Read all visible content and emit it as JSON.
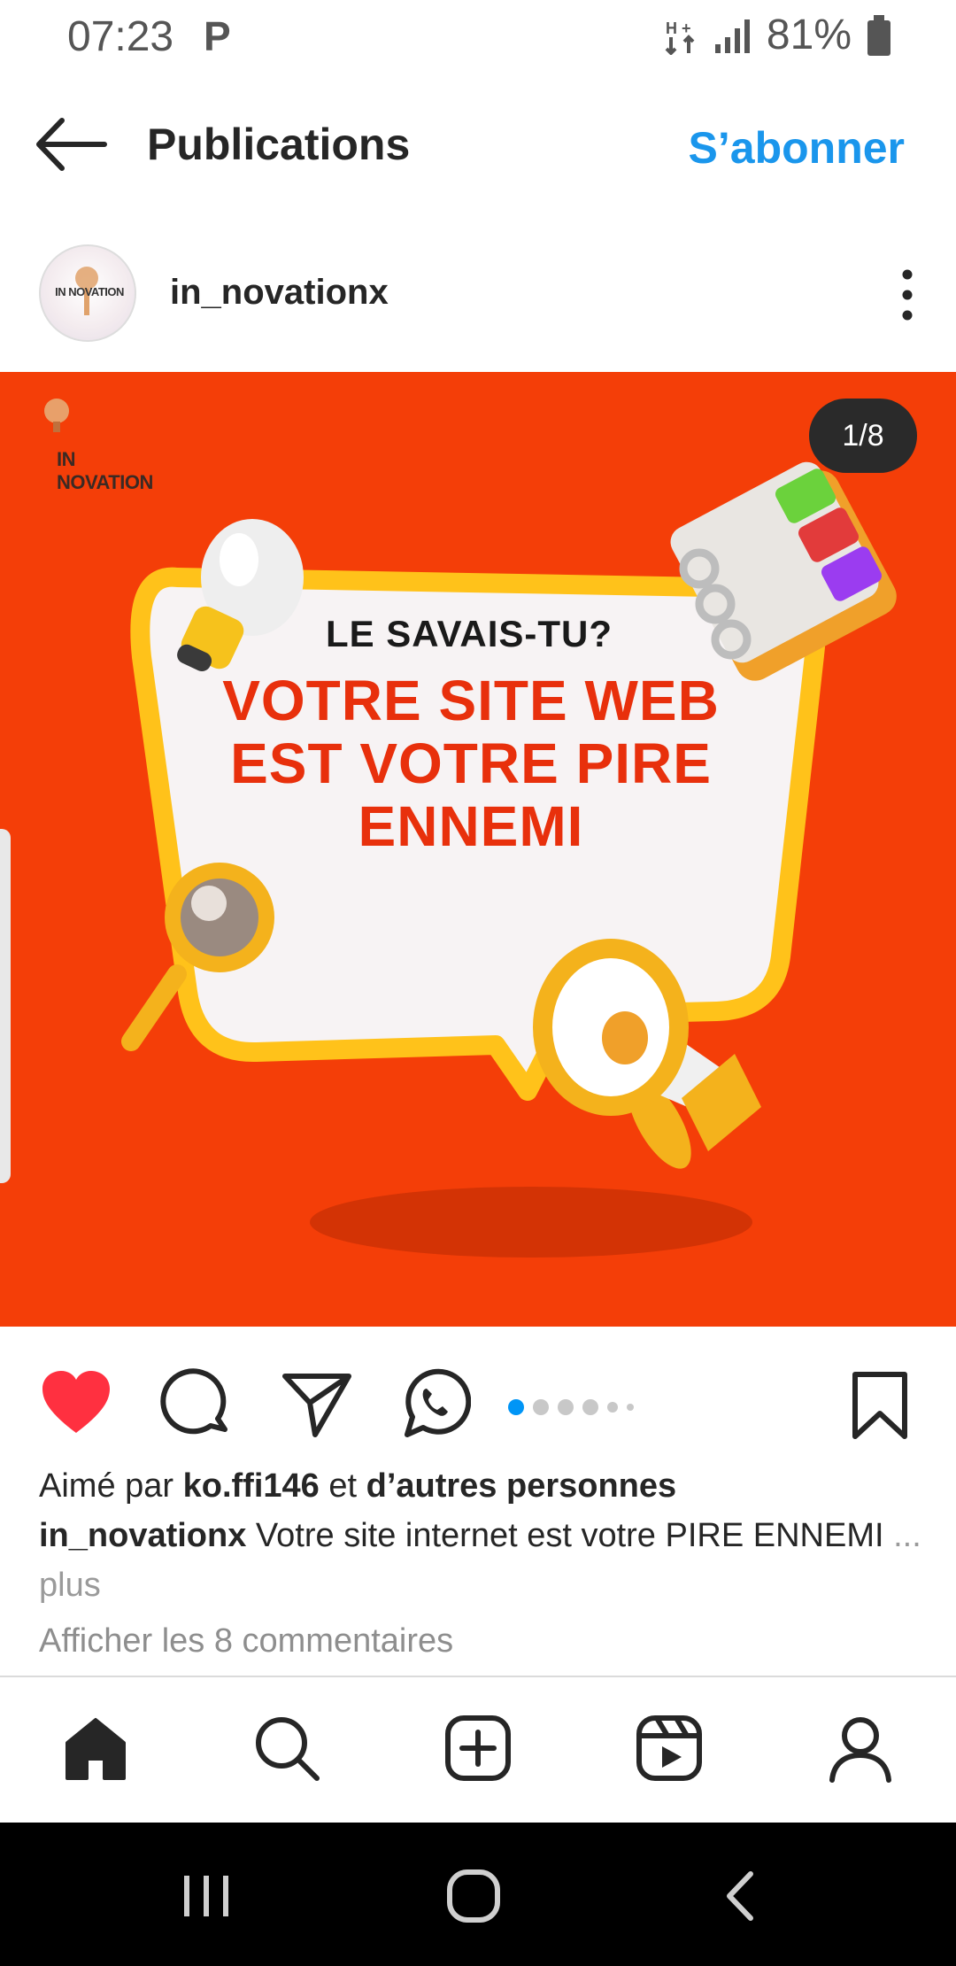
{
  "status_bar": {
    "time": "07:23",
    "p_icon": "P",
    "battery_percent": "81%",
    "icons": [
      "data-arrows-icon",
      "signal-icon",
      "battery-icon"
    ]
  },
  "header": {
    "back_icon": "arrow-left-icon",
    "title": "Publications",
    "follow_label": "S’abonner"
  },
  "post": {
    "username": "in_novationx",
    "avatar_text": "IN NOVATION",
    "more_icon": "vertical-dots-icon",
    "image": {
      "brand_logo_text": "IN NOVATION",
      "counter": "1/8",
      "kicker": "LE SAVAIS-TU?",
      "headline": "VOTRE SITE WEB EST VOTRE PIRE ENNEMI",
      "background_color": "#f43e08"
    },
    "actions": {
      "like_icon": "heart-icon",
      "liked": true,
      "comment_icon": "comment-icon",
      "share_icon": "send-icon",
      "whatsapp_icon": "whatsapp-icon",
      "save_icon": "bookmark-icon",
      "carousel_active_index": 1,
      "carousel_dot_count": 6
    },
    "likes": {
      "prefix": "Aimé par ",
      "user": "ko.ffi146",
      "middle": " et ",
      "others": "d’autres personnes"
    },
    "caption": {
      "author": "in_novationx",
      "text": " Votre site internet est votre PIRE ENNEMI ",
      "more": "... plus"
    },
    "comments_link": "Afficher les 8 commentaires"
  },
  "bottom_nav": {
    "items": [
      "home-icon",
      "search-icon",
      "create-icon",
      "reels-icon",
      "profile-icon"
    ]
  },
  "system_nav": {
    "items": [
      "recents-icon",
      "home-button-icon",
      "back-icon"
    ]
  },
  "colors": {
    "accent_blue": "#1a96ec",
    "like_red": "#ff3040",
    "headline_red": "#e8300c",
    "bubble_yellow": "#ffc21a"
  }
}
